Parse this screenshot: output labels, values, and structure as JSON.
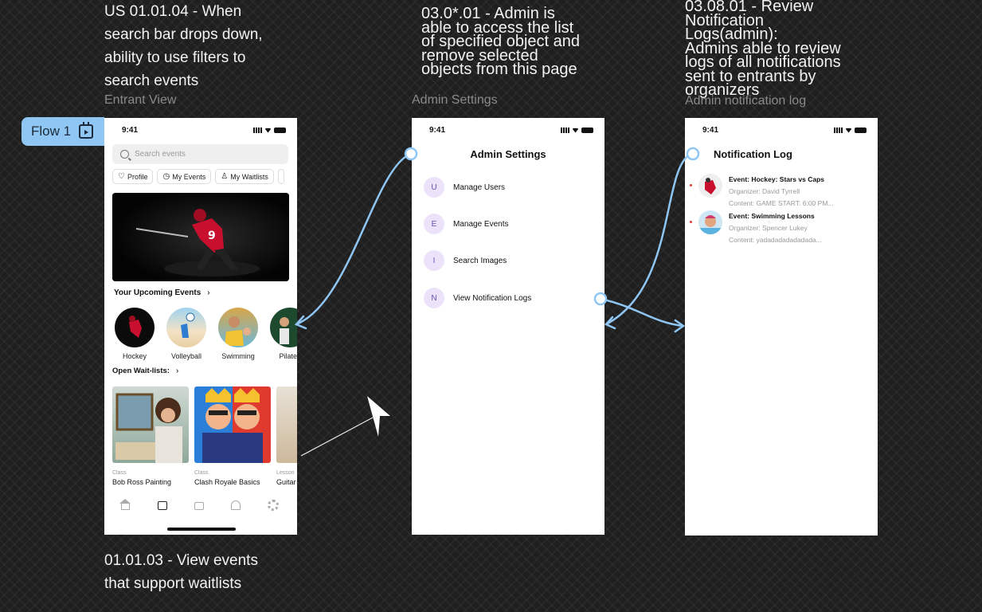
{
  "notes": {
    "top_left": "US 01.01.04 - When\nsearch bar drops down,\nability to use filters to\nsearch events",
    "top_middle": "03.0*.01 - Admin is\nable to access the list\nof specified object and\nremove selected\nobjects from this page",
    "top_right": "03.08.01 - Review\nNotification\nLogs(admin):\nAdmins able to review\nlogs of all notifications\nsent to entrants by\norganizers",
    "bottom_left": "01.01.03 - View events\nthat support waitlists"
  },
  "frame_labels": {
    "entrant": "Entrant View",
    "admin": "Admin Settings",
    "notif": "Admin notification log"
  },
  "flow_tag": "Flow 1",
  "status_time": "9:41",
  "entrant": {
    "search_placeholder": "Search events",
    "chips": [
      "Profile",
      "My Events",
      "My Waitlists"
    ],
    "upcoming_title": "Your Upcoming Events",
    "categories": [
      "Hockey",
      "Volleyball",
      "Swimming",
      "Pilates"
    ],
    "waitlists_title": "Open Wait-lists:",
    "cards": [
      {
        "kind": "Class",
        "title": "Bob Ross Painting"
      },
      {
        "kind": "Class",
        "title": "Clash Royale Basics"
      },
      {
        "kind": "Lesson",
        "title": "Guitar"
      }
    ]
  },
  "admin": {
    "title": "Admin Settings",
    "items": [
      {
        "letter": "U",
        "label": "Manage Users"
      },
      {
        "letter": "E",
        "label": "Manage Events"
      },
      {
        "letter": "I",
        "label": "Search Images"
      },
      {
        "letter": "N",
        "label": "View Notification Logs"
      }
    ]
  },
  "notif": {
    "title": "Notification Log",
    "items": [
      {
        "event": "Event: Hockey: Stars vs Caps",
        "organizer": "Organizer: David Tyrrell",
        "content": "Content: GAME START: 6:00 PM..."
      },
      {
        "event": "Event: Swimming Lessons",
        "organizer": "Organizer: Spencer Lukey",
        "content": "Content: yadadadadadadada..."
      }
    ]
  },
  "colors": {
    "accent": "#8fc6f3",
    "avatar_bg": "#ece3fb",
    "avatar_fg": "#6a4fb0",
    "unread": "#e53935"
  }
}
